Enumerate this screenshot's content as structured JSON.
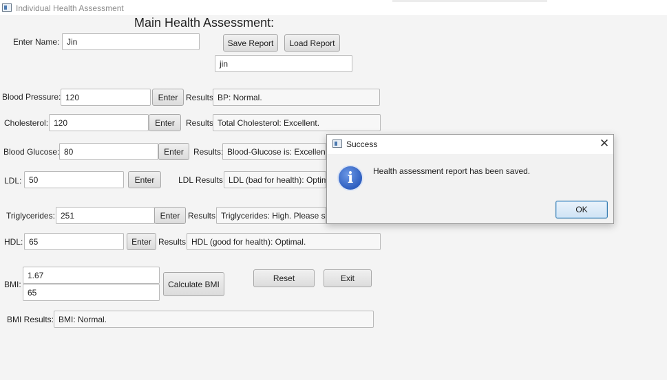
{
  "window": {
    "title": "Individual Health Assessment"
  },
  "heading": "Main Health Assessment:",
  "name": {
    "label": "Enter Name:",
    "value": "Jin"
  },
  "report": {
    "save_label": "Save Report",
    "load_label": "Load Report",
    "load_field_value": "jin"
  },
  "blood_pressure": {
    "label": "Blood Pressure:",
    "value": "120",
    "button": "Enter",
    "results_label": "Results:",
    "result": "BP: Normal."
  },
  "cholesterol": {
    "label": "Cholesterol:",
    "value": "120",
    "button": "Enter",
    "results_label": "Results:",
    "result": "Total Cholesterol: Excellent."
  },
  "blood_glucose": {
    "label": "Blood Glucose:",
    "value": "80",
    "button": "Enter",
    "results_label": "Results:",
    "result": "Blood-Glucose is: Excellent."
  },
  "ldl": {
    "label": "LDL:",
    "value": "50",
    "button": "Enter",
    "results_label": "LDL Results:",
    "result": "LDL (bad for health): Optimal."
  },
  "triglycerides": {
    "label": "Triglycerides:",
    "value": "251",
    "button": "Enter",
    "results_label": "Results:",
    "result": "Triglycerides: High. Please see a doctor."
  },
  "hdl": {
    "label": "HDL:",
    "value": "65",
    "button": "Enter",
    "results_label": "Results:",
    "result": "HDL (good for health): Optimal."
  },
  "bmi": {
    "label": "BMI:",
    "height_value": "1.67",
    "weight_value": "65",
    "calculate_label": "Calculate BMI",
    "results_label": "BMI Results:",
    "result": "BMI: Normal."
  },
  "actions": {
    "reset_label": "Reset",
    "exit_label": "Exit"
  },
  "dialog": {
    "title": "Success",
    "message": "Health assessment report has been saved.",
    "ok_label": "OK",
    "icon": "info-icon",
    "close_icon": "close-icon"
  },
  "colors": {
    "info_blue": "#2f5fbf",
    "ok_border": "#3c7fb1",
    "background": "#f4f4f4"
  }
}
